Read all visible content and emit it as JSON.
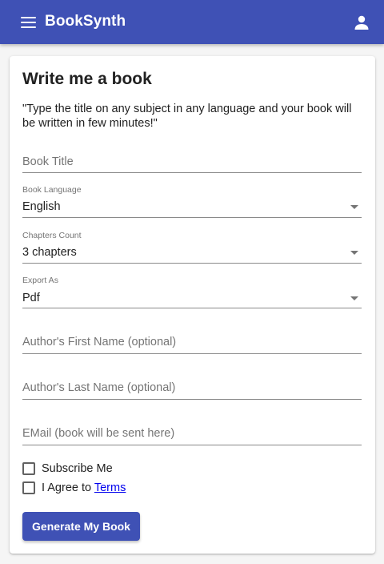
{
  "colors": {
    "primary": "#3f51b5",
    "link": "#0000ee"
  },
  "appbar": {
    "title": "BookSynth",
    "menu_icon": "menu-icon",
    "account_icon": "account-icon"
  },
  "form": {
    "heading": "Write me a book",
    "subtitle": "\"Type the title on any subject in any language and your book will be written in few minutes!\"",
    "book_title": {
      "placeholder": "Book Title",
      "value": ""
    },
    "language": {
      "label": "Book Language",
      "value": "English"
    },
    "chapters": {
      "label": "Chapters Count",
      "value": "3 chapters"
    },
    "export": {
      "label": "Export As",
      "value": "Pdf"
    },
    "first_name": {
      "placeholder": "Author's First Name (optional)",
      "value": ""
    },
    "last_name": {
      "placeholder": "Author's Last Name (optional)",
      "value": ""
    },
    "email": {
      "placeholder": "EMail (book will be sent here)",
      "value": ""
    },
    "subscribe": {
      "label": "Subscribe Me",
      "checked": false
    },
    "agree": {
      "label": "I Agree to",
      "link": "Terms",
      "checked": false
    },
    "submit_label": "Generate My Book"
  }
}
